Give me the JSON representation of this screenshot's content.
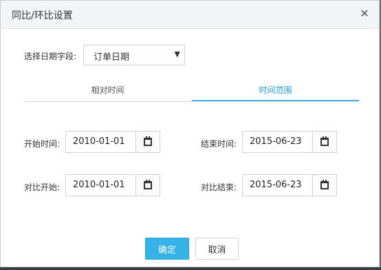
{
  "dialog": {
    "title": "同比/环比设置",
    "close_glyph": "✕"
  },
  "date_field": {
    "label": "选择日期字段:",
    "selected": "订单日期",
    "caret": "▼"
  },
  "tabs": [
    {
      "label": "相对时间",
      "active": false
    },
    {
      "label": "时间范围",
      "active": true
    }
  ],
  "fields": {
    "start": {
      "label": "开始时间:",
      "value": "2010-01-01"
    },
    "end": {
      "label": "结束时间:",
      "value": "2015-06-23"
    },
    "compare_start": {
      "label": "对比开始:",
      "value": "2010-01-01"
    },
    "compare_end": {
      "label": "对比结束:",
      "value": "2015-06-23"
    }
  },
  "buttons": {
    "confirm": "确定",
    "cancel": "取消"
  },
  "colors": {
    "accent": "#35b3e8",
    "tab_active": "#1e9be3"
  },
  "icons": {
    "close": "close-icon",
    "calendar": "calendar-icon",
    "caret": "caret-down-icon"
  }
}
